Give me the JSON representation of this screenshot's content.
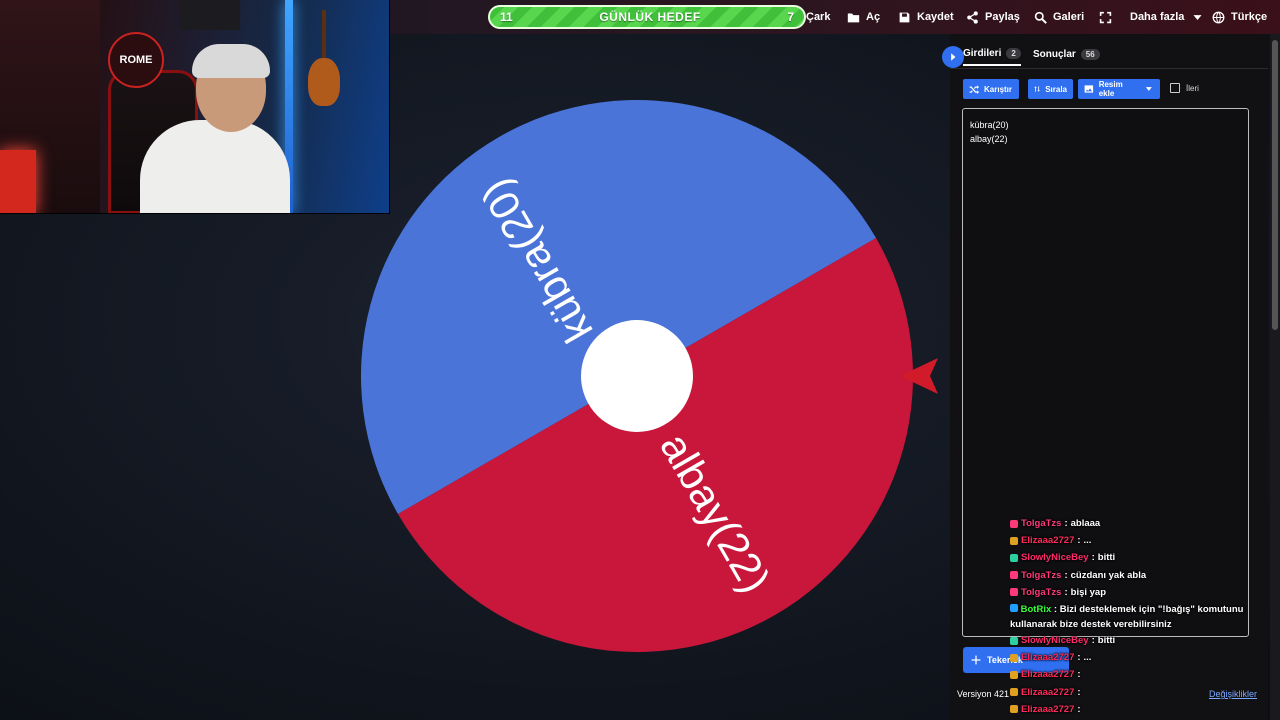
{
  "goal": {
    "left": "11",
    "title": "GÜNLÜK HEDEF",
    "right": "7"
  },
  "nav": {
    "wheel": "Çark",
    "open": "Aç",
    "save": "Kaydet",
    "share": "Paylaş",
    "gallery": "Galeri",
    "more": "Daha fazla",
    "language": "Türkçe"
  },
  "webcam": {
    "logo_text": "ROME"
  },
  "wheel": {
    "segments": [
      {
        "label": "kübra(20)",
        "color": "#4a74d8"
      },
      {
        "label": "albay(22)",
        "color": "#c8173a"
      }
    ],
    "hub_color": "#ffffff",
    "pointer_color": "#d11a2a"
  },
  "panel": {
    "tab_entries": "Girdileri",
    "tab_entries_count": "2",
    "tab_results": "Sonuçlar",
    "tab_results_count": "56",
    "shuffle": "Karıştır",
    "sort": "Sırala",
    "add_image": "Resim ekle",
    "advanced": "İleri",
    "entries": [
      "kübra(20)",
      "albay(22)"
    ],
    "add_wheel": "Tekerlek",
    "version": "Versiyon 421",
    "changes": "Değişiklikler"
  },
  "chat": [
    {
      "user": "TolgaTzs",
      "text": "ablaaa",
      "color": "#ff3a7a",
      "badge": "#ff3a7a"
    },
    {
      "user": "Elizaaa2727",
      "text": "...",
      "color": "#ff2a5a",
      "badge": "#e0a020"
    },
    {
      "user": "SlowlyNiceBey",
      "text": "bitti",
      "color": "#ff2a6a",
      "badge": "#2ecfa0"
    },
    {
      "user": "TolgaTzs",
      "text": "cüzdanı yak abla",
      "color": "#ff3a7a",
      "badge": "#ff3a7a"
    },
    {
      "user": "TolgaTzs",
      "text": "bişi yap",
      "color": "#ff3a7a",
      "badge": "#ff3a7a"
    },
    {
      "user": "BotRix",
      "text": "Bizi desteklemek için \"!bağış\" komutunu kullanarak bize destek verebilirsiniz",
      "color": "#3aff3a",
      "badge": "#1f9fff"
    },
    {
      "user": "SlowlyNiceBey",
      "text": "bitti",
      "color": "#ff2a6a",
      "badge": "#2ecfa0"
    },
    {
      "user": "Elizaaa2727",
      "text": "...",
      "color": "#ff2a5a",
      "badge": "#e0a020"
    },
    {
      "user": "Elizaaa2727",
      "text": "",
      "color": "#ff2a5a",
      "badge": "#e0a020"
    },
    {
      "user": "Elizaaa2727",
      "text": "",
      "color": "#ff2a5a",
      "badge": "#e0a020"
    },
    {
      "user": "Elizaaa2727",
      "text": "",
      "color": "#ff2a5a",
      "badge": "#e0a020"
    }
  ]
}
